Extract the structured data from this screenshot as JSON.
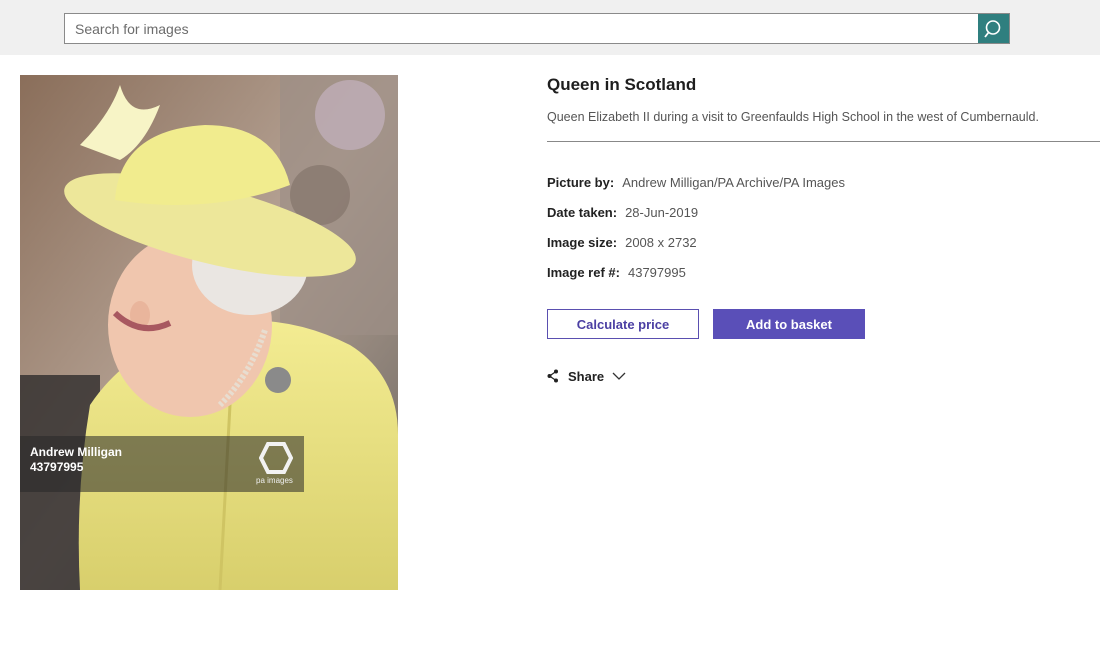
{
  "search": {
    "placeholder": "Search for images",
    "value": ""
  },
  "image": {
    "watermark": {
      "photographer": "Andrew Milligan",
      "ref": "43797995",
      "logo_text": "pa images"
    }
  },
  "details": {
    "title": "Queen in Scotland",
    "caption": "Queen Elizabeth II during a visit to Greenfaulds High School in the west of Cumbernauld.",
    "meta": [
      {
        "label": "Picture by:",
        "value": "Andrew Milligan/PA Archive/PA Images"
      },
      {
        "label": "Date taken:",
        "value": "28-Jun-2019"
      },
      {
        "label": "Image size:",
        "value": "2008 x 2732"
      },
      {
        "label": "Image ref #:",
        "value": "43797995"
      }
    ],
    "buttons": {
      "calculate": "Calculate price",
      "basket": "Add to basket"
    },
    "share": {
      "label": "Share"
    }
  },
  "colors": {
    "accent": "#5a4fb8",
    "search_button": "#2f7f7f",
    "topbar": "#f0f0f0"
  },
  "icons": [
    "search-icon",
    "share-icon",
    "chevron-down-icon",
    "pa-logo-icon"
  ]
}
